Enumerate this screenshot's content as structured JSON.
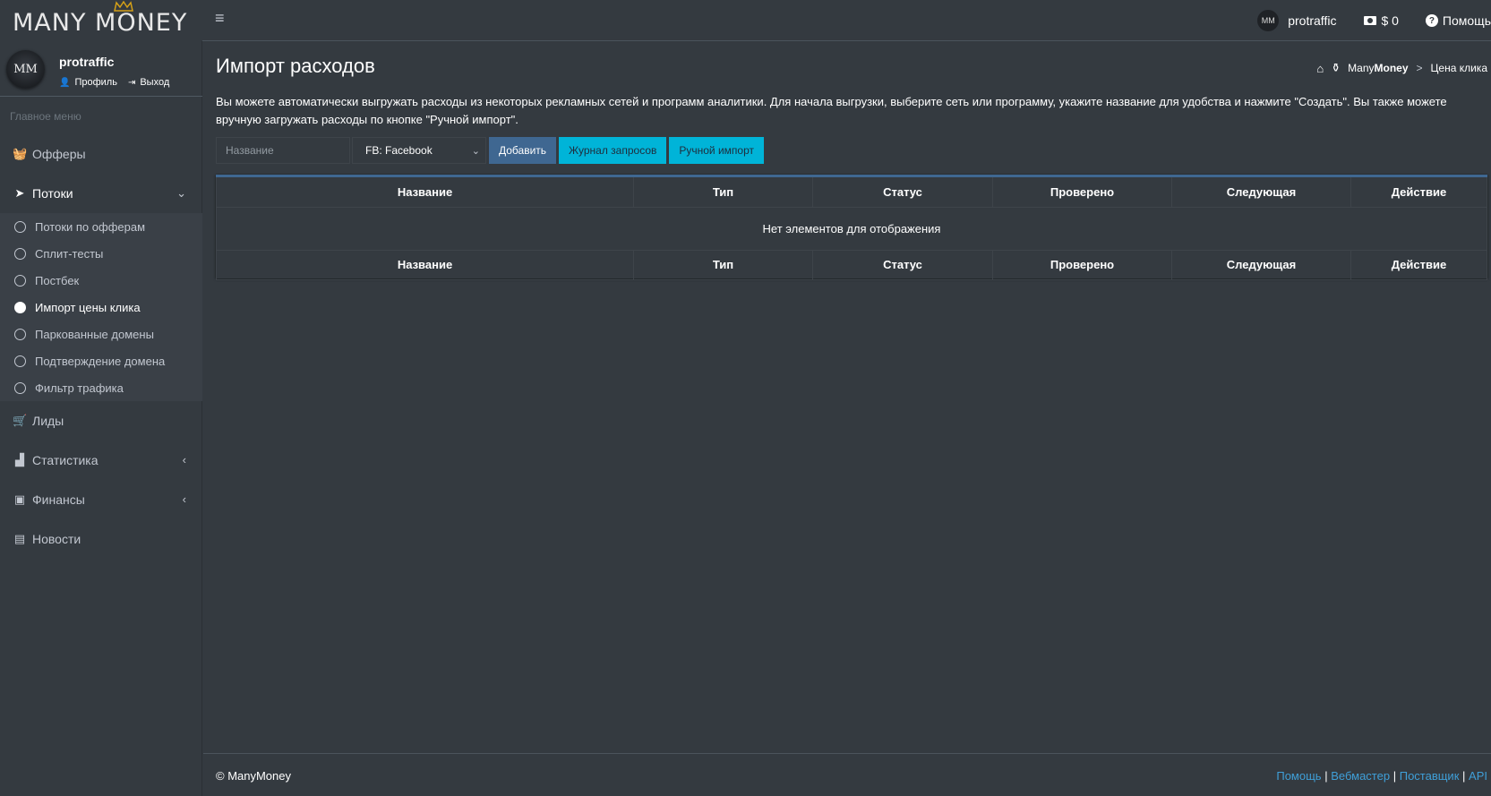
{
  "brand": {
    "name": "MANY MONEY"
  },
  "topbar": {
    "username": "protraffic",
    "balance": "$ 0",
    "help_label": "Помощь",
    "avatar_text": "MM"
  },
  "sidebar": {
    "user": {
      "name": "protraffic",
      "profile_label": "Профиль",
      "logout_label": "Выход",
      "avatar_text": "MM"
    },
    "menu_header": "Главное меню",
    "items": [
      {
        "label": "Офферы",
        "icon": "basket-icon"
      },
      {
        "label": "Потоки",
        "icon": "paper-plane-icon"
      },
      {
        "label": "Лиды",
        "icon": "cart-icon"
      },
      {
        "label": "Статистика",
        "icon": "chart-icon"
      },
      {
        "label": "Финансы",
        "icon": "money-icon"
      },
      {
        "label": "Новости",
        "icon": "newspaper-icon"
      }
    ],
    "subitems": [
      {
        "label": "Потоки по офферам"
      },
      {
        "label": "Сплит-тесты"
      },
      {
        "label": "Постбек"
      },
      {
        "label": "Импорт цены клика"
      },
      {
        "label": "Паркованные домены"
      },
      {
        "label": "Подтверждение домена"
      },
      {
        "label": "Фильтр трафика"
      }
    ]
  },
  "page": {
    "title": "Импорт расходов",
    "breadcrumb": {
      "root_prefix": "Many",
      "root_bold": "Money",
      "separator": ">",
      "current": "Цена клика"
    },
    "description": "Вы можете автоматически выгружать расходы из некоторых рекламных сетей и программ аналитики. Для начала выгрузки, выберите сеть или программу, укажите название для удобства и нажмите \"Создать\". Вы также можете вручную загружать расходы по кнопке \"Ручной импорт\"."
  },
  "form": {
    "name_placeholder": "Название",
    "network_selected": "FB: Facebook",
    "add_label": "Добавить",
    "log_label": "Журнал запросов",
    "manual_label": "Ручной импорт"
  },
  "table": {
    "columns": [
      "Название",
      "Тип",
      "Статус",
      "Проверено",
      "Следующая",
      "Действие"
    ],
    "empty_text": "Нет элементов для отображения"
  },
  "footer": {
    "copyright": "© ManyMoney",
    "links": [
      "Помощь",
      "Вебмастер",
      "Поставщик",
      "API"
    ],
    "separator": "|"
  },
  "colors": {
    "accent": "#3f6791",
    "info": "#00b4d8",
    "background": "#343a40",
    "link": "#3f9fd8"
  }
}
